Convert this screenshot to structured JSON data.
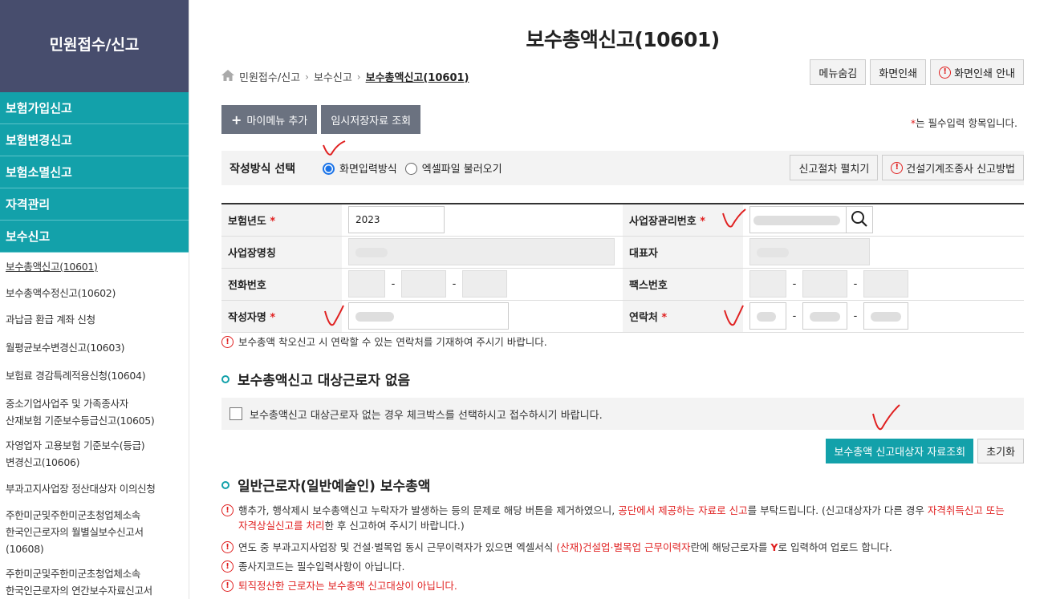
{
  "sidebar": {
    "title": "민원접수/신고",
    "main_menu": [
      "보험가입신고",
      "보험변경신고",
      "보험소멸신고",
      "자격관리",
      "보수신고"
    ],
    "sub_menu": [
      "보수총액신고(10601)",
      "보수총액수정신고(10602)",
      "과납금 환급 계좌 신청",
      "월평균보수변경신고(10603)",
      "보험료 경감특례적용신청(10604)",
      "중소기업사업주 및 가족종사자",
      "산재보험 기준보수등급신고(10605)",
      "자영업자 고용보험 기준보수(등급)",
      "변경신고(10606)",
      "부과고지사업장 정산대상자 이의신청",
      "주한미군및주한미군초청업체소속",
      "한국인근로자의 월별실보수신고서",
      "(10608)",
      "주한미군및주한미군초청업체소속",
      "한국인근로자의 연간보수자료신고서"
    ]
  },
  "page_title": "보수총액신고(10601)",
  "breadcrumb": [
    "민원접수/신고",
    "보수신고",
    "보수총액신고(10601)"
  ],
  "top_buttons": {
    "menu_hide": "메뉴숨김",
    "print": "화면인쇄",
    "print_guide": "화면인쇄 안내"
  },
  "toolbar": {
    "add_my_menu": "마이메뉴 추가",
    "temp_saved": "임시저장자료 조회",
    "required_note": "는 필수입력 항목입니다.",
    "required_mark": "*"
  },
  "method": {
    "label": "작성방식 선택",
    "options": [
      "화면입력방식",
      "엑셀파일 불러오기"
    ],
    "selected": "화면입력방식",
    "expand_button": "신고절차 펼치기",
    "construction_button": "건설기계조종사 신고방법"
  },
  "form": {
    "insurance_year_label": "보험년도",
    "insurance_year_value": "2023",
    "workplace_no_label": "사업장관리번호",
    "workplace_name_label": "사업장명칭",
    "representative_label": "대표자",
    "phone_label": "전화번호",
    "fax_label": "팩스번호",
    "writer_label": "작성자명",
    "contact_label": "연락처",
    "dash": "-"
  },
  "contact_notice": "보수총액 착오신고 시 연락할 수 있는 연락처를 기재하여 주시기 바랍니다.",
  "no_target": {
    "title": "보수총액신고 대상근로자 없음",
    "checkbox_label": "보수총액신고 대상근로자 없는 경우 체크박스를 선택하시고 접수하시기 바랍니다.",
    "checked": false
  },
  "actions": {
    "lookup": "보수총액 신고대상자 자료조회",
    "reset": "초기화"
  },
  "general": {
    "title": "일반근로자(일반예술인) 보수총액",
    "notice1": {
      "p1": "행추가, 행삭제시 보수총액신고 누락자가 발생하는 등의 문제로 해당 버튼을 제거하였으니, ",
      "r1": "공단에서 제공하는 자료로 신고",
      "p2": "를 부탁드립니다. (신고대상자가 다른 경우 ",
      "r2": "자격취득신고 또는 자격상실신고를 처리",
      "p3": "한 후 신고하여 주시기 바랍니다.)"
    },
    "notice2": {
      "p1": "연도 중 부과고지사업장 및 건설·벌목업 동시 근무이력자가 있으면 엑셀서식 ",
      "r1": "(산재)건설업·벌목업 근무이력자",
      "p2": "란에 해당근로자를 ",
      "r2": "Y",
      "p3": "로 입력하여 업로드 합니다."
    },
    "notice3": "종사지코드는 필수입력사항이 아닙니다.",
    "notice4": "퇴직정산한 근로자는 보수총액 신고대상이 아닙니다."
  },
  "icons": [
    "home-icon",
    "search-icon",
    "exclamation-icon",
    "plus-icon",
    "bullet-icon"
  ],
  "colors": {
    "teal": "#13a1aa",
    "sidebar_header": "#474d6d",
    "required_red": "#e02020",
    "radio_blue": "#1a73e8"
  }
}
